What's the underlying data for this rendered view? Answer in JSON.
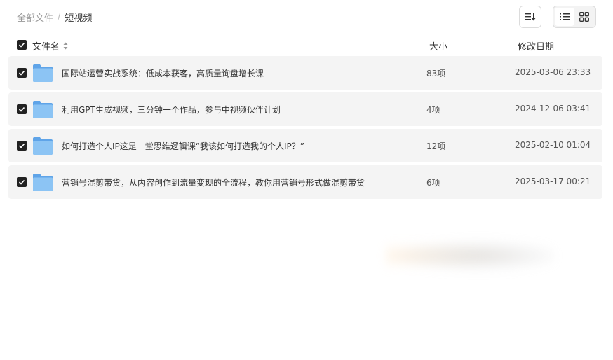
{
  "breadcrumb": {
    "root": "全部文件",
    "separator": "/",
    "current": "短视频"
  },
  "toolbar": {
    "sort_icon": "sort-icon",
    "list_view_icon": "list-view-icon",
    "grid_view_icon": "grid-view-icon"
  },
  "columns": {
    "name": "文件名",
    "size": "大小",
    "date": "修改日期"
  },
  "files": [
    {
      "name": "国际站运营实战系统：低成本获客，高质量询盘增长课",
      "size": "83项",
      "date": "2025-03-06 23:33"
    },
    {
      "name": "利用GPT生成视频，三分钟一个作品，参与中视频伙伴计划",
      "size": "4项",
      "date": "2024-12-06 03:41"
    },
    {
      "name": "如何打造个人IP这是一堂思维逻辑课“我该如何打造我的个人IP？”",
      "size": "12项",
      "date": "2025-02-10 01:04"
    },
    {
      "name": "营销号混剪带货，从内容创作到流量变现的全流程，教你用营销号形式做混剪带货",
      "size": "6项",
      "date": "2025-03-17 00:21"
    }
  ],
  "colors": {
    "row_bg": "#f4f4f4",
    "checkbox": "#222222",
    "folder": "#7ab8f0"
  }
}
